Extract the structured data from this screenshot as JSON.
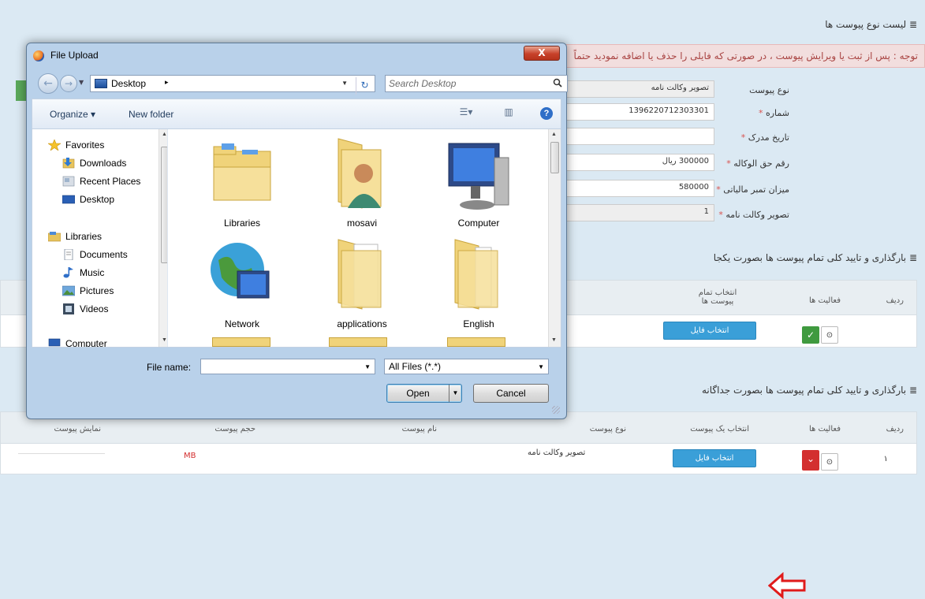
{
  "background": {
    "section1_title": "≣ لیست نوع پیوست ها",
    "notice": "توجه : پس از ثبت یا ویرایش پیوست ، در صورتی که فایلی را حذف یا اضافه نمودید حتماً",
    "form": [
      {
        "label": "نوع پیوست",
        "required": "",
        "value": "تصویر وکالت نامه"
      },
      {
        "label": "شماره",
        "required": "*",
        "value": "1396220712303301"
      },
      {
        "label": "تاریخ مدرک",
        "required": "*",
        "value": ""
      },
      {
        "label": "رقم حق الوکاله",
        "required": "*",
        "value": "300000 ریال"
      },
      {
        "label": "میزان تمبر مالیاتی",
        "required": "*",
        "value": "580000"
      },
      {
        "label": "تصویر وکالت نامه",
        "required": "*",
        "value": "1"
      }
    ],
    "section2_title": "≣ بارگذاری و تایید کلی تمام پیوست ها بصورت یکجا",
    "table1": {
      "headers": [
        "ردیف",
        "فعالیت ها",
        "انتخاب تمام پیوست ها"
      ],
      "file_button": "انتخاب فایل"
    },
    "section3_title": "≣ بارگذاری و تایید کلی تمام پیوست ها بصورت جداگانه",
    "table2": {
      "headers": [
        "ردیف",
        "فعالیت ها",
        "انتخاب یک پیوست",
        "نوع پیوست",
        "نام پیوست",
        "حجم پیوست",
        "نمایش پیوست"
      ],
      "row": {
        "index": "۱",
        "file_button": "انتخاب فایل",
        "type": "تصویر وکالت نامه",
        "size": "MB"
      }
    }
  },
  "dialog": {
    "title": "File Upload",
    "close": "X",
    "address": {
      "location": "Desktop",
      "separator": "▸"
    },
    "search": {
      "placeholder": "Search Desktop"
    },
    "toolbar": {
      "organize": "Organize ▾",
      "new_folder": "New folder"
    },
    "sidebar": {
      "items": [
        {
          "label": "Favorites"
        },
        {
          "label": "Downloads"
        },
        {
          "label": "Recent Places"
        },
        {
          "label": "Desktop"
        },
        {
          "label": "Libraries"
        },
        {
          "label": "Documents"
        },
        {
          "label": "Music"
        },
        {
          "label": "Pictures"
        },
        {
          "label": "Videos"
        },
        {
          "label": "Computer"
        }
      ]
    },
    "files": [
      {
        "label": "Libraries"
      },
      {
        "label": "mosavi"
      },
      {
        "label": "Computer"
      },
      {
        "label": "Network"
      },
      {
        "label": "applications"
      },
      {
        "label": "English"
      }
    ],
    "file_name": {
      "label": "File name:",
      "value": ""
    },
    "filter": "All Files (*.*)",
    "buttons": {
      "open": "Open",
      "cancel": "Cancel"
    }
  }
}
